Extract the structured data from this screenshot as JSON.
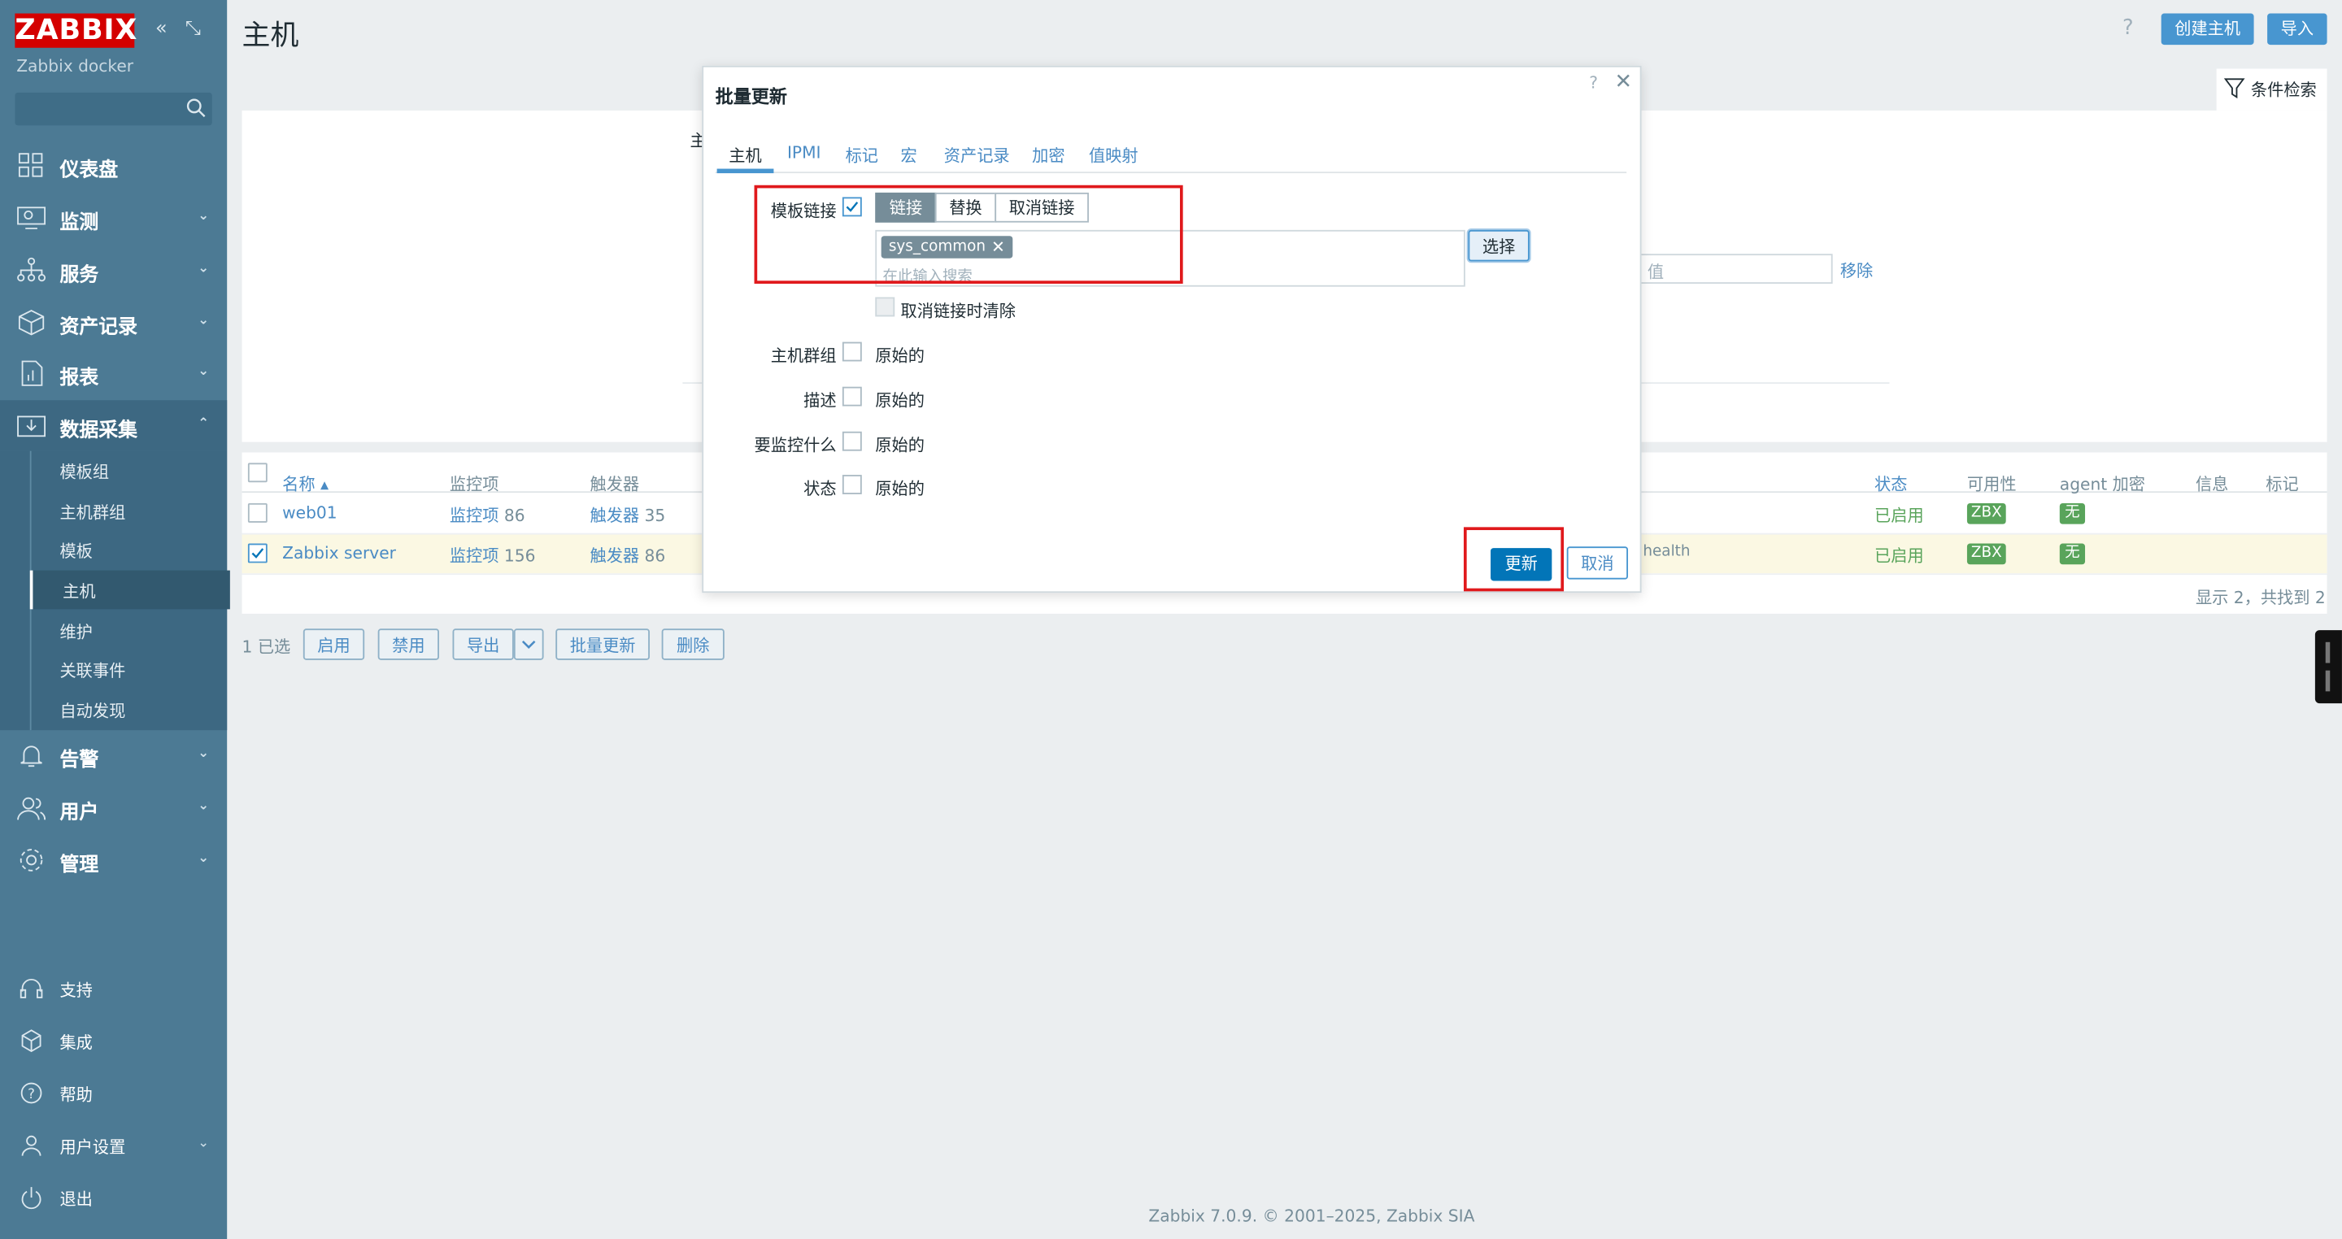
{
  "sidebar": {
    "logo": "ZABBIX",
    "server_name": "Zabbix docker",
    "search_placeholder": "",
    "menu": [
      {
        "label": "仪表盘",
        "icon": "dashboard-icon"
      },
      {
        "label": "监测",
        "icon": "monitoring-icon"
      },
      {
        "label": "服务",
        "icon": "services-icon"
      },
      {
        "label": "资产记录",
        "icon": "inventory-icon"
      },
      {
        "label": "报表",
        "icon": "reports-icon"
      },
      {
        "label": "数据采集",
        "icon": "data-collection-icon"
      }
    ],
    "data_collection_items": [
      "模板组",
      "主机群组",
      "模板",
      "主机",
      "维护",
      "关联事件",
      "自动发现"
    ],
    "menu_after": [
      {
        "label": "告警",
        "icon": "bell-icon"
      },
      {
        "label": "用户",
        "icon": "users-icon"
      },
      {
        "label": "管理",
        "icon": "gear-icon"
      }
    ],
    "footer": [
      {
        "label": "支持",
        "icon": "headset-icon"
      },
      {
        "label": "集成",
        "icon": "integrations-icon"
      },
      {
        "label": "帮助",
        "icon": "help-icon"
      },
      {
        "label": "用户设置",
        "icon": "user-settings-icon"
      },
      {
        "label": "退出",
        "icon": "power-icon"
      }
    ]
  },
  "header": {
    "title": "主机",
    "help": "?",
    "create_host": "创建主机",
    "import": "导入"
  },
  "filter": {
    "toggle_label": "条件检索",
    "partial_label": "主",
    "value_placeholder": "值",
    "remove_link": "移除"
  },
  "table": {
    "headers": {
      "name": "名称 ▴",
      "items": "监控项",
      "triggers": "触发器",
      "status": "状态",
      "availability": "可用性",
      "agent_encryption": "agent 加密",
      "info": "信息",
      "tags": "标记"
    },
    "rows": [
      {
        "name": "web01",
        "items": "监控项",
        "items_count": "86",
        "triggers": "触发器",
        "triggers_count": "35",
        "status": "已启用",
        "availability": "ZBX",
        "encryption": "无",
        "checked": false,
        "tags": ""
      },
      {
        "name": "Zabbix server",
        "items": "监控项",
        "items_count": "156",
        "triggers": "触发器",
        "triggers_count": "86",
        "status": "已启用",
        "availability": "ZBX",
        "encryption": "无",
        "checked": true,
        "tags": "health"
      }
    ],
    "summary": "显示 2，共找到 2"
  },
  "actions": {
    "selected": "1 已选",
    "enable": "启用",
    "disable": "禁用",
    "export": "导出",
    "mass_update": "批量更新",
    "delete": "删除"
  },
  "modal": {
    "title": "批量更新",
    "help": "?",
    "tabs": [
      "主机",
      "IPMI",
      "标记",
      "宏",
      "资产记录",
      "加密",
      "值映射"
    ],
    "active_tab": "主机",
    "template_link_label": "模板链接",
    "template_link_checked": true,
    "segments": [
      "链接",
      "替换",
      "取消链接"
    ],
    "active_segment": "链接",
    "selected_template": "sys_common",
    "search_placeholder": "在此输入搜索",
    "select_button": "选择",
    "clear_on_unlink": "取消链接时清除",
    "fields": [
      {
        "label": "主机群组",
        "value": "原始的"
      },
      {
        "label": "描述",
        "value": "原始的"
      },
      {
        "label": "要监控什么",
        "value": "原始的"
      },
      {
        "label": "状态",
        "value": "原始的"
      }
    ],
    "update_button": "更新",
    "cancel_button": "取消"
  },
  "footer": "Zabbix 7.0.9. © 2001–2025, Zabbix SIA",
  "colors": {
    "sidebar": "#4c7a94",
    "primary": "#0275b8",
    "link": "#4a8bc4",
    "highlight": "#e0191c",
    "enabled": "#59a45b"
  }
}
